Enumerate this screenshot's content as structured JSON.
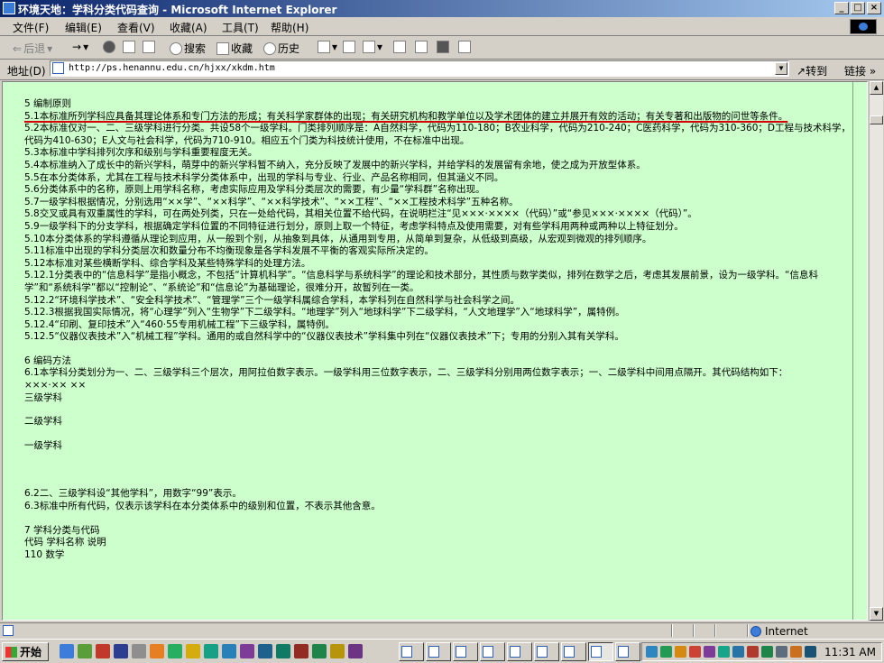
{
  "window": {
    "title": "环境天地：学科分类代码查询 - Microsoft Internet Explorer"
  },
  "menu": [
    "文件(F)",
    "编辑(E)",
    "查看(V)",
    "收藏(A)",
    "工具(T)",
    "帮助(H)"
  ],
  "toolbar": {
    "back": "后退",
    "search": "搜索",
    "favorites": "收藏",
    "history": "历史"
  },
  "address": {
    "label": "地址(D)",
    "url": "http://ps.henannu.edu.cn/hjxx/xkdm.htm",
    "go": "转到",
    "links": "链接"
  },
  "document": {
    "lines": [
      "5 编制原则",
      "5.1本标准所列学科应具备其理论体系和专门方法的形成；有关科学家群体的出现；有关研究机构和教学单位以及学术团体的建立并展开有效的活动；有关专著和出版物的问世等条件。",
      "5.2本标准仅对一、二、三级学科进行分类。共设58个一级学科。门类排列顺序是：A自然科学，代码为110-180；B农业科学，代码为210-240；C医药科学，代码为310-360；D工程与技术科学，代码为410-630；E人文与社会科学，代码为710-910。相应五个门类为科技统计使用，不在标准中出现。",
      "5.3本标准中学科排列次序和级别与学科重要程度无关。",
      "5.4本标准纳入了成长中的新兴学科，萌芽中的新兴学科暂不纳入，充分反映了发展中的新兴学科，并给学科的发展留有余地，使之成为开放型体系。",
      "5.5在本分类体系，尤其在工程与技术科学分类体系中，出现的学科与专业、行业、产品名称相同，但其涵义不同。",
      "5.6分类体系中的名称，原则上用学科名称，考虑实际应用及学科分类层次的需要，有少量“学科群”名称出现。",
      "5.7一级学科根据情况，分别选用“××学”、“××科学”、“××科学技术”、“××工程”、“××工程技术科学”五种名称。",
      "5.8交叉或具有双重属性的学科，可在两处列类，只在一处给代码，其相关位置不给代码，在说明栏注“见×××·××××（代码）”或“参见×××·××××（代码）”。",
      "5.9一级学科下的分支学科，根据确定学科位置的不同特征进行划分，原则上取一个特征，考虑学科特点及使用需要，对有些学科用两种或两种以上特征划分。",
      "5.10本分类体系的学科遵循从理论到应用，从一般到个别，从抽象到具体，从通用到专用，从简单到复杂，从低级到高级，从宏观到微观的排列顺序。",
      "5.11标准中出现的学科分类层次和数量分布不均衡现象是各学科发展不平衡的客观实际所决定的。",
      "5.12本标准对某些横断学科、综合学科及某些特殊学科的处理方法。",
      "5.12.1分类表中的“信息科学”是指小概念，不包括“计算机科学”。“信息科学与系统科学”的理论和技术部分，其性质与数学类似，排列在数学之后，考虑其发展前景，设为一级学科。“信息科学”和“系统科学”都以“控制论”、“系统论”和“信息论”为基础理论，很难分开，故暂列在一类。",
      "5.12.2“环境科学技术”、“安全科学技术”、“管理学”三个一级学科属综合学科，本学科列在自然科学与社会科学之间。",
      "5.12.3根据我国实际情况，将“心理学”列入“生物学”下二级学科。“地理学”列入“地球科学”下二级学科，“人文地理学”入“地球科学”，属特例。",
      "5.12.4“印刷、复印技术”入“460·55专用机械工程”下三级学科，属特例。",
      "5.12.5“仪器仪表技术”入“机械工程”学科。通用的或自然科学中的“仪器仪表技术”学科集中列在“仪器仪表技术”下；专用的分别入其有关学科。",
      "",
      "6 编码方法",
      "6.1本学科分类划分为一、二、三级学科三个层次，用阿拉伯数字表示。一级学科用三位数字表示，二、三级学科分别用两位数字表示；一、二级学科中间用点隔开。其代码结构如下：",
      "×××·×× ××",
      "三级学科",
      "",
      "二级学科",
      "",
      "一级学科",
      "",
      "",
      "",
      "6.2二、三级学科设“其他学科”，用数字“99”表示。",
      "6.3标准中所有代码，仅表示该学科在本分类体系中的级别和位置，不表示其他含意。",
      "",
      "7 学科分类与代码",
      "代码 学科名称 说明",
      "110 数学"
    ]
  },
  "status": {
    "zone": "Internet"
  },
  "taskbar": {
    "start": "开始",
    "clock": "11:31 AM"
  }
}
